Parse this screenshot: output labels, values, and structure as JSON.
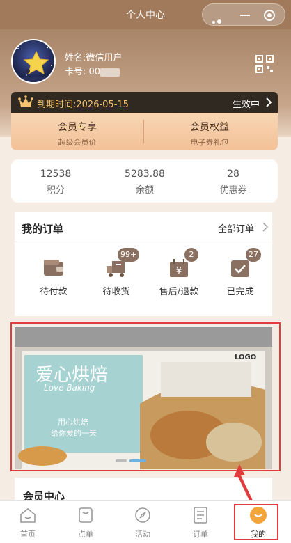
{
  "header": {
    "title": "个人中心"
  },
  "user": {
    "name": "姓名:微信用户",
    "card_label": "卡号: 00"
  },
  "vip": {
    "expire": "到期时间:2026-05-15",
    "status": "生效中",
    "actions": [
      {
        "main": "会员专享",
        "sub": "超级会员价"
      },
      {
        "main": "会员权益",
        "sub": "电子券礼包"
      }
    ]
  },
  "stats": [
    {
      "value": "12538",
      "label": "积分"
    },
    {
      "value": "5283.88",
      "label": "余额"
    },
    {
      "value": "28",
      "label": "优惠券"
    }
  ],
  "orders": {
    "title": "我的订单",
    "all": "全部订单",
    "items": [
      {
        "label": "待付款",
        "badge": ""
      },
      {
        "label": "待收货",
        "badge": "99+"
      },
      {
        "label": "售后/退款",
        "badge": "2"
      },
      {
        "label": "已完成",
        "badge": "27"
      }
    ]
  },
  "banner": {
    "title": "爱心烘焙",
    "subtitle": "Love Baking",
    "tagline1": "用心烘焙",
    "tagline2": "给你爱的一天",
    "logo": "LOGO"
  },
  "member_center": {
    "title": "会员中心"
  },
  "tabbar": [
    {
      "label": "首页",
      "icon": "home-icon"
    },
    {
      "label": "点单",
      "icon": "cup-icon"
    },
    {
      "label": "活动",
      "icon": "compass-icon"
    },
    {
      "label": "订单",
      "icon": "list-icon"
    },
    {
      "label": "我的",
      "icon": "smile-icon"
    }
  ],
  "colors": {
    "accent": "#f3a43b",
    "highlight": "#e23b3b",
    "gold": "#f5c36f"
  }
}
